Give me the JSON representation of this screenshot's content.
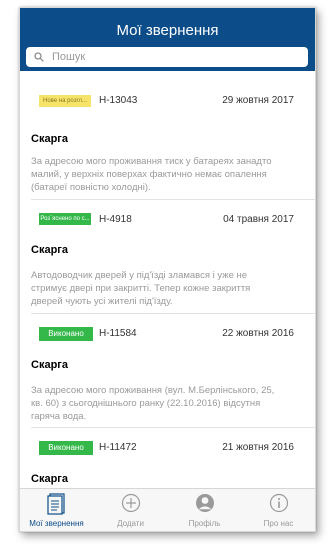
{
  "header": {
    "title": "Мої звернення"
  },
  "search": {
    "placeholder": "Пошук"
  },
  "colors": {
    "brand": "#0c4d89",
    "status_new": "#f5e36a",
    "status_review": "#35b84a",
    "status_done": "#35b84a",
    "muted_text": "#9a9a9a"
  },
  "requests": [
    {
      "status": "Нове на розгл...",
      "ticket": "Н-13043",
      "date": "29 жовтня 2017",
      "title": "Скарга",
      "lines": [
        "За адресою мого проживання тиск у батареях занадто",
        "малий, у верхніх поверхах фактично немає опалення",
        "(батареї повністю холодні)."
      ]
    },
    {
      "status": "Роз`яснено по с...",
      "ticket": "Н-4918",
      "date": "04 травня 2017",
      "title": "Скарга",
      "lines": [
        "Автодоводчик дверей у під'їзді зламався і уже не",
        "стримує двері при закритті. Тепер кожне закриття",
        "дверей чують усі жителі під'їзду."
      ]
    },
    {
      "status": "Виконано",
      "ticket": "Н-11584",
      "date": "22 жовтня 2016",
      "title": "Скарга",
      "lines": [
        "За адресою мого проживання (вул. М.Берлінського, 25,",
        "кв. 60) з сьогоднішнього ранку (22.10.2016) відсутня",
        "гаряча вода."
      ]
    },
    {
      "status": "Виконано",
      "ticket": "Н-11472",
      "date": "21 жовтня 2016",
      "title": "Скарга",
      "lines": []
    }
  ],
  "tabbar": {
    "items": [
      {
        "label": "Мої звернення",
        "icon": "list-icon",
        "active": true
      },
      {
        "label": "Додати",
        "icon": "add-icon",
        "active": false
      },
      {
        "label": "Профіль",
        "icon": "profile-icon",
        "active": false
      },
      {
        "label": "Про нас",
        "icon": "info-icon",
        "active": false
      }
    ]
  }
}
